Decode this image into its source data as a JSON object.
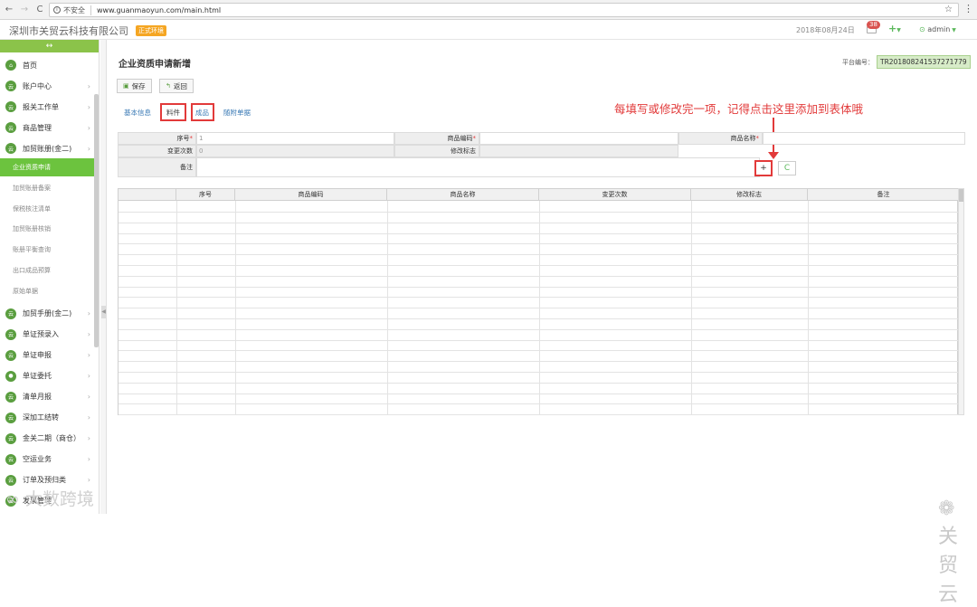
{
  "browser": {
    "back": "←",
    "forward": "→",
    "reload": "C",
    "security": "不安全",
    "url": "www.guanmaoyun.com/main.html",
    "star": "☆",
    "menu": "⋮"
  },
  "header": {
    "company": "深圳市关贸云科技有限公司",
    "badge": "正式环境",
    "date": "2018年08月24日",
    "notif_count": "38",
    "plus": "+",
    "user": "admin"
  },
  "sidebar": {
    "collapse": "↔",
    "items": [
      {
        "label": "首页",
        "icon": "home-icon"
      },
      {
        "label": "账户中心",
        "icon": "cloud-icon"
      },
      {
        "label": "报关工作单",
        "icon": "cloud-icon"
      },
      {
        "label": "商品管理",
        "icon": "cloud-icon"
      },
      {
        "label": "加贸账册(金二)",
        "icon": "cloud-icon"
      }
    ],
    "subitems": [
      {
        "label": "企业资质申请",
        "active": true
      },
      {
        "label": "加贸账册备案",
        "active": false
      },
      {
        "label": "保税核注清单",
        "active": false
      },
      {
        "label": "加贸账册核销",
        "active": false
      },
      {
        "label": "账册平衡查询",
        "active": false
      },
      {
        "label": "出口成品预算",
        "active": false
      },
      {
        "label": "原始单据",
        "active": false
      }
    ],
    "items2": [
      {
        "label": "加贸手册(金二)",
        "icon": "cloud-icon"
      },
      {
        "label": "单证预录入",
        "icon": "cloud-icon"
      },
      {
        "label": "单证申报",
        "icon": "cloud-icon"
      },
      {
        "label": "单证委托",
        "icon": "person-icon"
      },
      {
        "label": "清单月报",
        "icon": "cloud-icon"
      },
      {
        "label": "深加工结转",
        "icon": "cloud-icon"
      },
      {
        "label": "金关二期（商仓）",
        "icon": "cloud-icon"
      },
      {
        "label": "空运业务",
        "icon": "cloud-icon"
      },
      {
        "label": "订单及预归类",
        "icon": "cloud-icon"
      },
      {
        "label": "发票管理",
        "icon": "cloud-icon"
      }
    ]
  },
  "main": {
    "title": "企业资质申请新增",
    "platform_label": "平台编号：",
    "platform_value": "TR201808241537271779",
    "save": "保存",
    "back": "返回",
    "tabs": [
      "基本信息",
      "料件",
      "成品",
      "随附单据"
    ],
    "annotation": "每填写或修改完一项，记得点击这里添加到表体哦",
    "form": {
      "seq_label": "序号",
      "seq_value": "1",
      "code_label": "商品编码",
      "name_label": "商品名称",
      "change_label": "变更次数",
      "change_value": "0",
      "mod_label": "修改标志",
      "note_label": "备注",
      "add_btn": "+",
      "refresh_btn": "C"
    },
    "grid_headers": [
      "序号",
      "商品编码",
      "商品名称",
      "变更次数",
      "修改标志",
      "备注"
    ]
  },
  "watermarks": {
    "brand": "关贸云",
    "source": "大数跨境"
  }
}
